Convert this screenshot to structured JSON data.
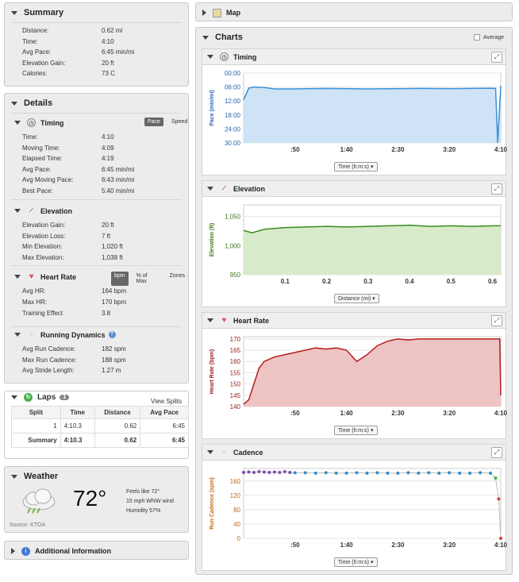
{
  "summary": {
    "title": "Summary",
    "rows": [
      {
        "k": "Distance:",
        "v": "0.62 mi"
      },
      {
        "k": "Time:",
        "v": "4:10"
      },
      {
        "k": "Avg Pace:",
        "v": "6:45 min/mi"
      },
      {
        "k": "Elevation Gain:",
        "v": "20 ft"
      },
      {
        "k": "Calories:",
        "v": "73 C"
      }
    ]
  },
  "details": {
    "title": "Details",
    "timing": {
      "title": "Timing",
      "pace_label": "Pace",
      "speed_label": "Speed",
      "rows": [
        {
          "k": "Time:",
          "v": "4:10"
        },
        {
          "k": "Moving Time:",
          "v": "4:09"
        },
        {
          "k": "Elapsed Time:",
          "v": "4:19"
        },
        {
          "k": "Avg Pace:",
          "v": "6:45 min/mi"
        },
        {
          "k": "Avg Moving Pace:",
          "v": "6:43 min/mi"
        },
        {
          "k": "Best Pace:",
          "v": "5:40 min/mi"
        }
      ]
    },
    "elevation": {
      "title": "Elevation",
      "rows": [
        {
          "k": "Elevation Gain:",
          "v": "20 ft"
        },
        {
          "k": "Elevation Loss:",
          "v": "7 ft"
        },
        {
          "k": "Min Elevation:",
          "v": "1,020 ft"
        },
        {
          "k": "Max Elevation:",
          "v": "1,038 ft"
        }
      ]
    },
    "heart_rate": {
      "title": "Heart Rate",
      "bpm_label": "bpm",
      "pct_label": "% of Max",
      "zones_label": "Zones",
      "rows": [
        {
          "k": "Avg HR:",
          "v": "164 bpm"
        },
        {
          "k": "Max HR:",
          "v": "170 bpm"
        },
        {
          "k": "Training Effect",
          "v": "3.8"
        }
      ]
    },
    "running_dynamics": {
      "title": "Running Dynamics",
      "rows": [
        {
          "k": "Avg Run Cadence:",
          "v": "182 spm"
        },
        {
          "k": "Max Run Cadence:",
          "v": "188 spm"
        },
        {
          "k": "Avg Stride Length:",
          "v": "1.27 m"
        }
      ]
    }
  },
  "laps": {
    "title": "Laps",
    "count": "1",
    "view_splits": "View Splits",
    "headers": [
      "Split",
      "Time",
      "Distance",
      "Avg Pace"
    ],
    "rows": [
      [
        "1",
        "4:10.3",
        "0.62",
        "6:45"
      ],
      [
        "Summary",
        "4:10.3",
        "0.62",
        "6:45"
      ]
    ]
  },
  "weather": {
    "title": "Weather",
    "temp": "72°",
    "feels": "Feels like 72°",
    "wind": "15 mph WNW wind",
    "humidity": "Humidity 57%",
    "source": "Source: KTOA"
  },
  "additional": {
    "title": "Additional Information"
  },
  "map": {
    "title": "Map"
  },
  "charts": {
    "title": "Charts",
    "average_label": "Average",
    "timing": {
      "title": "Timing",
      "select": "Time (h:m:s)"
    },
    "elevation": {
      "title": "Elevation",
      "select": "Distance (mi)"
    },
    "heart_rate": {
      "title": "Heart Rate",
      "select": "Time (h:m:s)"
    },
    "cadence": {
      "title": "Cadence",
      "select": "Time (h:m:s)"
    }
  },
  "chart_data": [
    {
      "type": "area",
      "title": "Timing",
      "ylabel": "Pace (min/mi)",
      "y_tick_labels": [
        "00:00",
        "06:00",
        "12:00",
        "18:00",
        "24:00",
        "30:00"
      ],
      "x_tick_labels": [
        ":50",
        "1:40",
        "2:30",
        "3:20",
        "4:10"
      ],
      "x": [
        0,
        5,
        10,
        20,
        30,
        50,
        80,
        100,
        120,
        150,
        170,
        200,
        220,
        240,
        245,
        247,
        250
      ],
      "y_min": [
        11.5,
        6.5,
        6.0,
        6.2,
        6.8,
        6.8,
        6.6,
        6.7,
        6.8,
        6.7,
        6.6,
        6.7,
        6.6,
        6.5,
        6.6,
        30,
        5.5
      ],
      "ylim_min": [
        0,
        30
      ],
      "inverted": true,
      "color": "#3a8fd6"
    },
    {
      "type": "area",
      "title": "Elevation",
      "ylabel": "Elevation (ft)",
      "y_tick_labels": [
        "950",
        "1,000",
        "1,050"
      ],
      "x_tick_labels": [
        "0.1",
        "0.2",
        "0.3",
        "0.4",
        "0.5",
        "0.6"
      ],
      "x": [
        0,
        0.02,
        0.05,
        0.1,
        0.15,
        0.2,
        0.25,
        0.3,
        0.35,
        0.4,
        0.45,
        0.5,
        0.55,
        0.6,
        0.62
      ],
      "y": [
        1026,
        1022,
        1028,
        1031,
        1032,
        1033,
        1032,
        1033,
        1034,
        1035,
        1033,
        1034,
        1033,
        1034,
        1034
      ],
      "ylim": [
        950,
        1070
      ],
      "xlim": [
        0,
        0.62
      ],
      "color": "#3b8a1f"
    },
    {
      "type": "area",
      "title": "Heart Rate",
      "ylabel": "Heart Rate (bpm)",
      "y_tick_labels": [
        "140",
        "145",
        "150",
        "155",
        "160",
        "165",
        "170"
      ],
      "x_tick_labels": [
        ":50",
        "1:40",
        "2:30",
        "3:20",
        "4:10"
      ],
      "x": [
        0,
        5,
        10,
        15,
        20,
        30,
        40,
        50,
        60,
        70,
        80,
        90,
        100,
        110,
        120,
        130,
        140,
        150,
        160,
        170,
        180,
        200,
        220,
        240,
        249,
        250
      ],
      "y": [
        141,
        143,
        150,
        157,
        160,
        162,
        163,
        164,
        165,
        166,
        165.5,
        166,
        165,
        160,
        163,
        167,
        169,
        170,
        169.5,
        170,
        170,
        170,
        170,
        170,
        170,
        145
      ],
      "ylim": [
        140,
        171
      ],
      "xlim": [
        0,
        250
      ],
      "color": "#b71c1c"
    },
    {
      "type": "scatter",
      "title": "Cadence",
      "ylabel": "Run Cadence (spm)",
      "y_tick_labels": [
        "0",
        "40",
        "80",
        "120",
        "160"
      ],
      "x_tick_labels": [
        ":50",
        "1:40",
        "2:30",
        "3:20",
        "4:10"
      ],
      "x": [
        0,
        5,
        10,
        15,
        20,
        25,
        30,
        35,
        40,
        45,
        50,
        60,
        70,
        80,
        90,
        100,
        110,
        120,
        130,
        140,
        150,
        160,
        170,
        180,
        190,
        200,
        210,
        220,
        230,
        240,
        245,
        248,
        250
      ],
      "y": [
        184,
        185,
        184,
        186,
        185,
        184,
        185,
        184,
        186,
        184,
        183,
        183,
        182,
        183,
        182,
        182,
        183,
        182,
        183,
        182,
        182,
        183,
        182,
        183,
        182,
        183,
        182,
        182,
        183,
        182,
        168,
        110,
        0
      ],
      "ylim": [
        0,
        195
      ],
      "xlim": [
        0,
        250
      ]
    }
  ]
}
